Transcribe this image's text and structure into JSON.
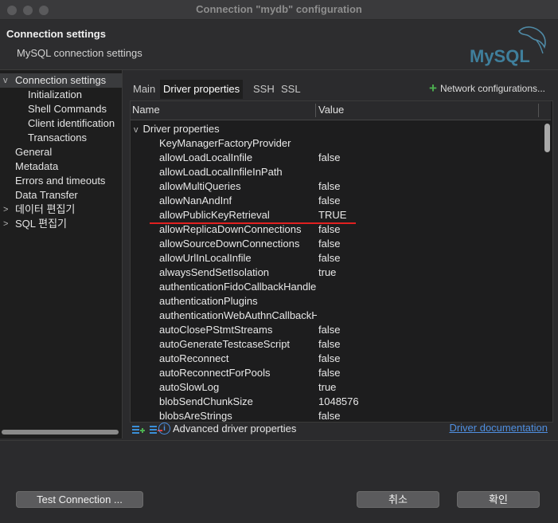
{
  "window": {
    "title": "Connection \"mydb\" configuration"
  },
  "header": {
    "title": "Connection settings",
    "subtitle": "MySQL connection settings",
    "logo_text": "MySQL"
  },
  "nav": {
    "items": [
      {
        "label": "Connection settings",
        "chevron": "v",
        "selected": true
      },
      {
        "label": "Initialization"
      },
      {
        "label": "Shell Commands"
      },
      {
        "label": "Client identification"
      },
      {
        "label": "Transactions"
      },
      {
        "label": "General"
      },
      {
        "label": "Metadata"
      },
      {
        "label": "Errors and timeouts"
      },
      {
        "label": "Data Transfer"
      },
      {
        "label": "데이터 편집기",
        "chevron": ">"
      },
      {
        "label": "SQL 편집기",
        "chevron": ">"
      }
    ]
  },
  "tabs": [
    {
      "label": "Main"
    },
    {
      "label": "Driver properties",
      "active": true
    },
    {
      "label": "SSH"
    },
    {
      "label": "SSL"
    }
  ],
  "network_config_label": "Network configurations...",
  "table": {
    "columns": [
      "Name",
      "Value"
    ],
    "group_label": "Driver properties",
    "group_chevron": "v",
    "rows": [
      {
        "name": "KeyManagerFactoryProvider",
        "value": ""
      },
      {
        "name": "allowLoadLocalInfile",
        "value": "false"
      },
      {
        "name": "allowLoadLocalInfileInPath",
        "value": ""
      },
      {
        "name": "allowMultiQueries",
        "value": "false"
      },
      {
        "name": "allowNanAndInf",
        "value": "false"
      },
      {
        "name": "allowPublicKeyRetrieval",
        "value": "TRUE"
      },
      {
        "name": "allowReplicaDownConnections",
        "value": "false"
      },
      {
        "name": "allowSourceDownConnections",
        "value": "false"
      },
      {
        "name": "allowUrlInLocalInfile",
        "value": "false"
      },
      {
        "name": "alwaysSendSetIsolation",
        "value": "true"
      },
      {
        "name": "authenticationFidoCallbackHandler",
        "value": ""
      },
      {
        "name": "authenticationPlugins",
        "value": ""
      },
      {
        "name": "authenticationWebAuthnCallbackHandler",
        "value": ""
      },
      {
        "name": "autoClosePStmtStreams",
        "value": "false"
      },
      {
        "name": "autoGenerateTestcaseScript",
        "value": "false"
      },
      {
        "name": "autoReconnect",
        "value": "false"
      },
      {
        "name": "autoReconnectForPools",
        "value": "false"
      },
      {
        "name": "autoSlowLog",
        "value": "true"
      },
      {
        "name": "blobSendChunkSize",
        "value": "1048576"
      },
      {
        "name": "blobsAreStrings",
        "value": "false"
      }
    ]
  },
  "panel_footer": {
    "advanced_label": "Advanced driver properties",
    "doc_link": "Driver documentation",
    "info_glyph": "i"
  },
  "footer": {
    "test_button": "Test Connection ...",
    "cancel_button": "취소",
    "ok_button": "확인"
  },
  "colors": {
    "highlight_underline": "#e02020",
    "link": "#4f8fe0",
    "add_green": "#4cb050"
  }
}
